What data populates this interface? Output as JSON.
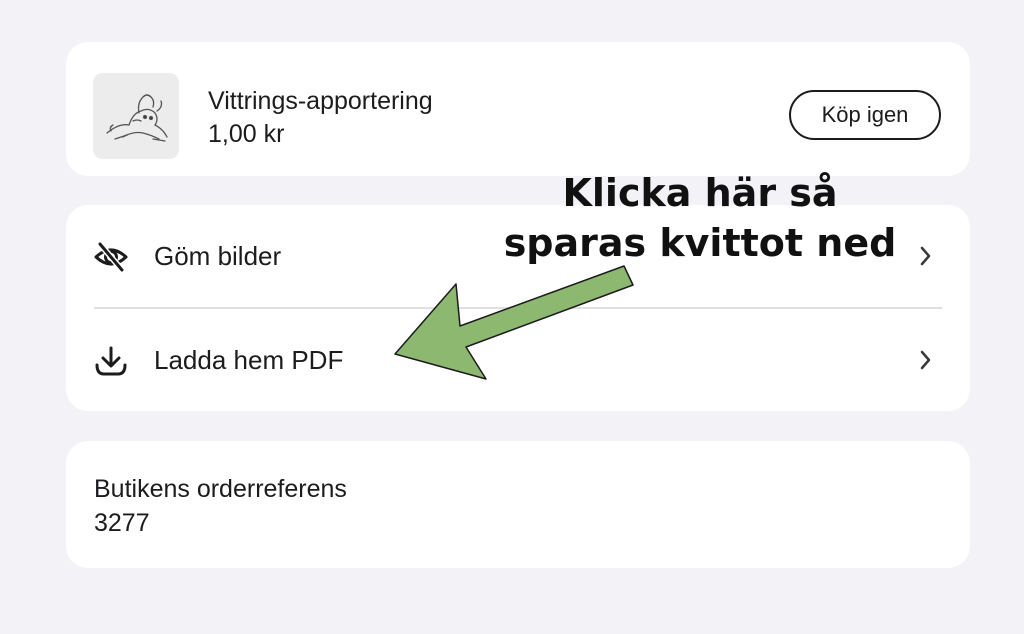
{
  "product": {
    "title": "Vittrings-apportering",
    "price": "1,00 kr",
    "buy_again_label": "Köp igen",
    "thumbnail_icon": "dog-sketch-image"
  },
  "actions": {
    "items": [
      {
        "label": "Göm bilder",
        "icon": "eye-slash-icon"
      },
      {
        "label": "Ladda hem PDF",
        "icon": "download-icon"
      }
    ]
  },
  "order_reference": {
    "label": "Butikens orderreferens",
    "value": "3277"
  },
  "annotation": {
    "line1": "Klicka här så",
    "line2": "sparas kvittot ned",
    "arrow_color": "#8db870"
  }
}
